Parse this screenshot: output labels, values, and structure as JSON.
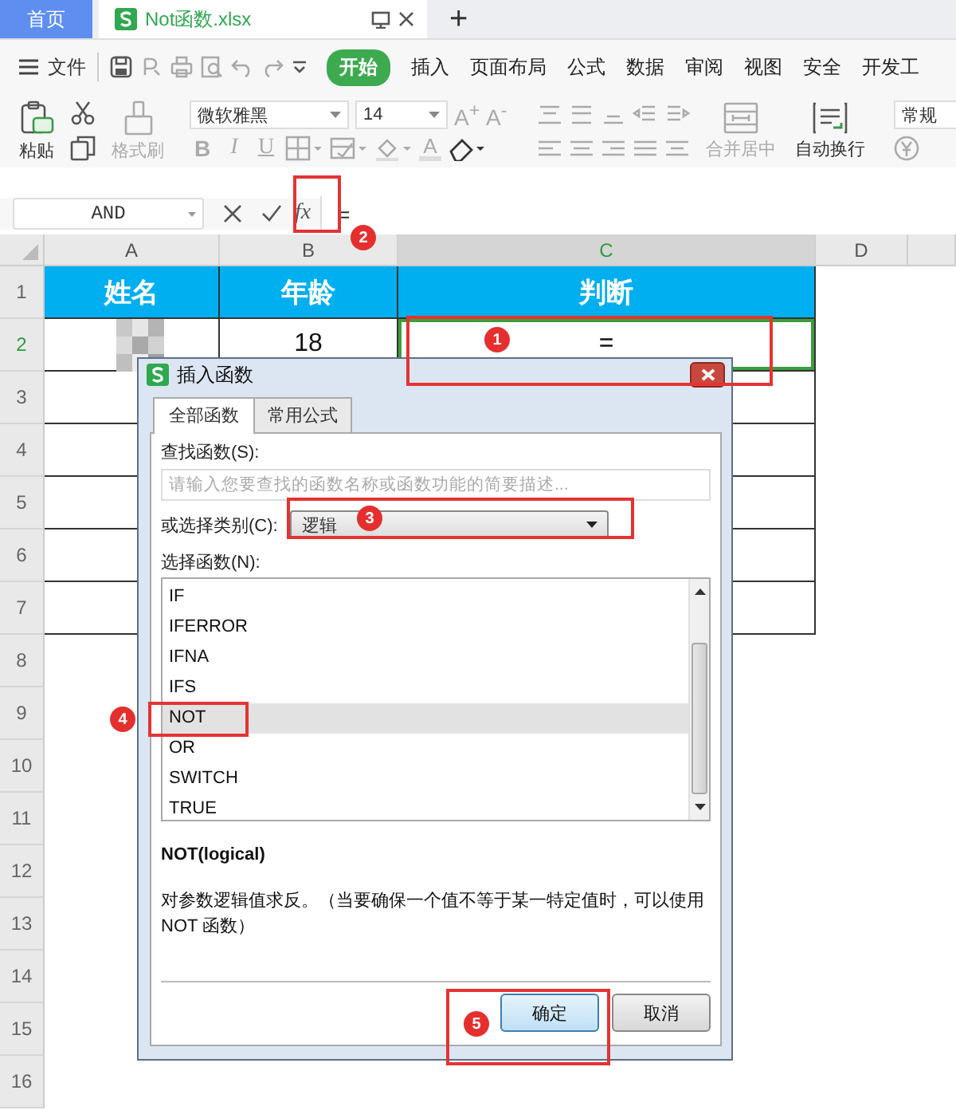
{
  "tabs": [
    {
      "label": "首页",
      "kind": "home",
      "selected": false
    },
    {
      "label": "Not函数.xlsx",
      "kind": "document",
      "selected": true
    }
  ],
  "new_tab": "+",
  "menu": {
    "file": "文件",
    "items": [
      {
        "label": "开始",
        "selected": true
      },
      {
        "label": "插入",
        "selected": false
      },
      {
        "label": "页面布局",
        "selected": false
      },
      {
        "label": "公式",
        "selected": false
      },
      {
        "label": "数据",
        "selected": false
      },
      {
        "label": "审阅",
        "selected": false
      },
      {
        "label": "视图",
        "selected": false
      },
      {
        "label": "安全",
        "selected": false
      },
      {
        "label": "开发工",
        "selected": false
      }
    ]
  },
  "ribbon": {
    "paste": "粘贴",
    "format_painter": "格式刷",
    "font": "微软雅黑",
    "font_size": "14",
    "grow": "A$^{+}$",
    "shrink": "A$^{-}$",
    "bold": "B",
    "italic": "I",
    "underline": "U",
    "font_color": "A",
    "merge": "合并居中",
    "wrap": "自动换行",
    "number_format": "常规"
  },
  "formula_bar": {
    "name_box": "AND",
    "function_label": "fx",
    "value": "="
  },
  "sheet": {
    "columns": [
      {
        "label": "A",
        "selected": false
      },
      {
        "label": "B",
        "selected": false
      },
      {
        "label": "C",
        "selected": true
      },
      {
        "label": "D",
        "selected": false
      }
    ],
    "row_numbers": [
      {
        "label": "1",
        "selected": false
      },
      {
        "label": "2",
        "selected": true
      },
      {
        "label": "3",
        "selected": false
      },
      {
        "label": "4",
        "selected": false
      },
      {
        "label": "5",
        "selected": false
      },
      {
        "label": "6",
        "selected": false
      },
      {
        "label": "7",
        "selected": false
      },
      {
        "label": "8",
        "selected": false
      },
      {
        "label": "9",
        "selected": false
      },
      {
        "label": "10",
        "selected": false
      },
      {
        "label": "11",
        "selected": false
      },
      {
        "label": "12",
        "selected": false
      },
      {
        "label": "13",
        "selected": false
      },
      {
        "label": "14",
        "selected": false
      },
      {
        "label": "15",
        "selected": false
      },
      {
        "label": "16",
        "selected": false
      }
    ],
    "table": [
      {
        "kind": "header",
        "cells": [
          {
            "text": "姓名"
          },
          {
            "text": "年龄"
          },
          {
            "text": "判断"
          }
        ]
      },
      {
        "kind": "data",
        "cells": [
          {
            "kind": "picture"
          },
          {
            "text": "18"
          },
          {
            "text": "=",
            "active": true
          }
        ]
      },
      {
        "kind": "data",
        "cells": [
          {},
          {},
          {}
        ]
      },
      {
        "kind": "data",
        "cells": [
          {},
          {},
          {}
        ]
      },
      {
        "kind": "data",
        "cells": [
          {},
          {},
          {}
        ]
      },
      {
        "kind": "data",
        "cells": [
          {},
          {},
          {}
        ]
      },
      {
        "kind": "data",
        "cells": [
          {},
          {},
          {}
        ]
      }
    ]
  },
  "dialog": {
    "title": "插入函数",
    "tabs": [
      {
        "label": "全部函数",
        "selected": true
      },
      {
        "label": "常用公式",
        "selected": false
      }
    ],
    "search_label": "查找函数(S):",
    "search_placeholder": "请输入您要查找的函数名称或函数功能的简要描述...",
    "category_label": "或选择类别(C):",
    "category": "逻辑",
    "list_label": "选择函数(N):",
    "functions": [
      {
        "name": "IF",
        "selected": false
      },
      {
        "name": "IFERROR",
        "selected": false
      },
      {
        "name": "IFNA",
        "selected": false
      },
      {
        "name": "IFS",
        "selected": false
      },
      {
        "name": "NOT",
        "selected": true
      },
      {
        "name": "OR",
        "selected": false
      },
      {
        "name": "SWITCH",
        "selected": false
      },
      {
        "name": "TRUE",
        "selected": false
      }
    ],
    "signature": "NOT(logical)",
    "description": "对参数逻辑值求反。（当要确保一个值不等于某一特定值时，可以使用 NOT 函数）",
    "buttons": [
      {
        "label": "确定",
        "kind": "primary"
      },
      {
        "label": "取消",
        "kind": "secondary"
      }
    ]
  },
  "annotations": [
    {
      "number": "1"
    },
    {
      "number": "2"
    },
    {
      "number": "3"
    },
    {
      "number": "4"
    },
    {
      "number": "5"
    }
  ]
}
